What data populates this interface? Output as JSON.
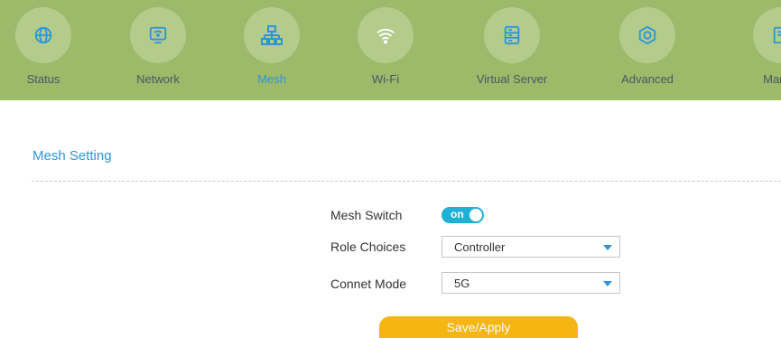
{
  "nav": {
    "items": [
      {
        "label": "Status",
        "icon": "globe-icon"
      },
      {
        "label": "Network",
        "icon": "monitor-icon"
      },
      {
        "label": "Mesh",
        "icon": "sitemap-icon",
        "active": true
      },
      {
        "label": "Wi-Fi",
        "icon": "wifi-icon"
      },
      {
        "label": "Virtual Server",
        "icon": "server-icon"
      },
      {
        "label": "Advanced",
        "icon": "hexagon-icon"
      },
      {
        "label": "Manag",
        "icon": "manage-icon"
      }
    ]
  },
  "section": {
    "title": "Mesh Setting"
  },
  "form": {
    "mesh_switch_label": "Mesh Switch",
    "mesh_switch_value": "on",
    "role_label": "Role Choices",
    "role_value": "Controller",
    "mode_label": "Connet Mode",
    "mode_value": "5G",
    "save_label": "Save/Apply"
  },
  "colors": {
    "nav_bg": "#9cba6a",
    "accent": "#2c95d8",
    "toggle": "#1fb0d6",
    "save_button": "#f5b512"
  }
}
